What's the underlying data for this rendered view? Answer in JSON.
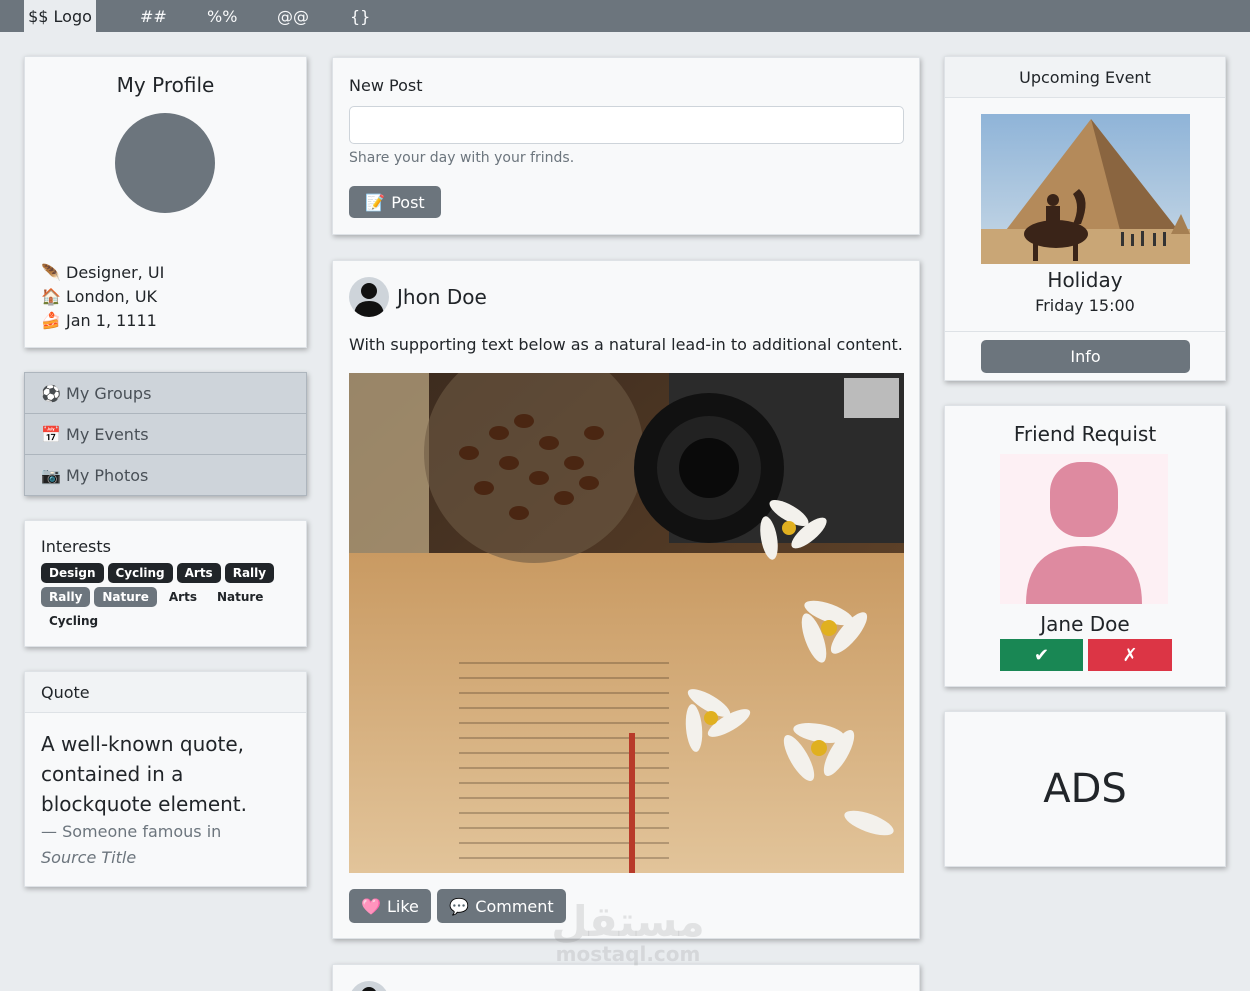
{
  "navbar": {
    "brand": "$$ Logo",
    "links": [
      "##",
      "%%",
      "@@",
      "{}"
    ]
  },
  "profile": {
    "title": "My Profile",
    "role_icon": "🪶",
    "role": "Designer, UI",
    "location_icon": "🏠",
    "location": "London, UK",
    "birthday_icon": "🍰",
    "birthday": "Jan 1, 1111"
  },
  "menu": {
    "items": [
      {
        "icon": "⚽",
        "label": "My Groups"
      },
      {
        "icon": "📅",
        "label": "My Events"
      },
      {
        "icon": "📷",
        "label": "My Photos"
      }
    ]
  },
  "interests": {
    "title": "Interests",
    "badges": [
      {
        "label": "Design",
        "style": "dark"
      },
      {
        "label": "Cycling",
        "style": "dark"
      },
      {
        "label": "Arts",
        "style": "dark"
      },
      {
        "label": "Rally",
        "style": "dark"
      },
      {
        "label": "Rally",
        "style": "gray"
      },
      {
        "label": "Nature",
        "style": "gray"
      },
      {
        "label": "Arts",
        "style": "light"
      },
      {
        "label": "Nature",
        "style": "light"
      },
      {
        "label": "Cycling",
        "style": "light"
      }
    ]
  },
  "quote": {
    "header": "Quote",
    "text": "A well-known quote, contained in a blockquote element.",
    "footer_prefix": "— Someone famous in",
    "source": "Source Title"
  },
  "new_post": {
    "title": "New Post",
    "input_value": "",
    "help": "Share your day with your frinds.",
    "button_icon": "📝",
    "button": "Post"
  },
  "post": {
    "author": "Jhon Doe",
    "text": "With supporting text below as a natural lead-in to additional content.",
    "like_icon": "🩷",
    "like": "Like",
    "comment_icon": "💬",
    "comment": "Comment"
  },
  "event": {
    "header": "Upcoming Event",
    "name": "Holiday",
    "time": "Friday 15:00",
    "button": "Info"
  },
  "friend": {
    "title": "Friend Requist",
    "name": "Jane Doe",
    "accept": "✔",
    "reject": "✗"
  },
  "ads": {
    "text": "ADS"
  },
  "watermark": {
    "arabic": "مستقل",
    "latin": "mostaql.com"
  }
}
